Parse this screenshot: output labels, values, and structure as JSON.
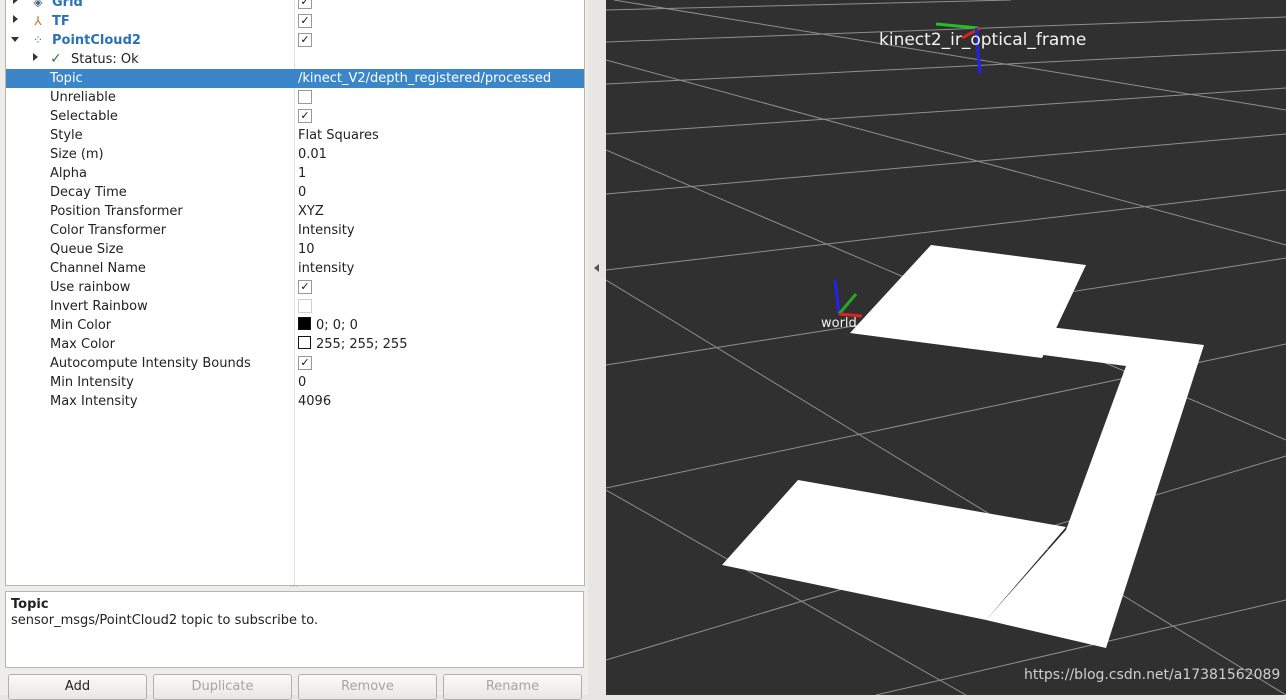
{
  "displays": [
    {
      "label": "Grid",
      "checked": true,
      "expanded": false,
      "icon": "grid-icon"
    },
    {
      "label": "TF",
      "checked": true,
      "expanded": false,
      "icon": "tf-icon"
    },
    {
      "label": "PointCloud2",
      "checked": true,
      "expanded": true,
      "icon": "pointcloud-icon"
    }
  ],
  "status": {
    "label": "Status: Ok"
  },
  "properties": [
    {
      "name": "Topic",
      "value": "/kinect_V2/depth_registered/processed",
      "selected": true
    },
    {
      "name": "Unreliable",
      "checkbox": true,
      "checked": false
    },
    {
      "name": "Selectable",
      "checkbox": true,
      "checked": true
    },
    {
      "name": "Style",
      "value": "Flat Squares"
    },
    {
      "name": "Size (m)",
      "value": "0.01"
    },
    {
      "name": "Alpha",
      "value": "1"
    },
    {
      "name": "Decay Time",
      "value": "0"
    },
    {
      "name": "Position Transformer",
      "value": "XYZ"
    },
    {
      "name": "Color Transformer",
      "value": "Intensity"
    },
    {
      "name": "Queue Size",
      "value": "10"
    },
    {
      "name": "Channel Name",
      "value": "intensity"
    },
    {
      "name": "Use rainbow",
      "checkbox": true,
      "checked": true
    },
    {
      "name": "Invert Rainbow",
      "checkbox": true,
      "checked": false
    },
    {
      "name": "Min Color",
      "value": "0; 0; 0",
      "swatch": "#000000"
    },
    {
      "name": "Max Color",
      "value": "255; 255; 255",
      "swatch": "#ffffff"
    },
    {
      "name": "Autocompute Intensity Bounds",
      "checkbox": true,
      "checked": true
    },
    {
      "name": "Min Intensity",
      "value": "0"
    },
    {
      "name": "Max Intensity",
      "value": "4096"
    }
  ],
  "description": {
    "title": "Topic",
    "text": "sensor_msgs/PointCloud2 topic to subscribe to."
  },
  "buttons": {
    "add": "Add",
    "duplicate": "Duplicate",
    "remove": "Remove",
    "rename": "Rename"
  },
  "viewport": {
    "frames": {
      "kinect": "kinect2_ir_optical_frame",
      "world": "world"
    },
    "background_color": "#303030",
    "grid_color": "#a0a0a0",
    "pointcloud_color": "#ffffff"
  },
  "watermark": "https://blog.csdn.net/a17381562089"
}
